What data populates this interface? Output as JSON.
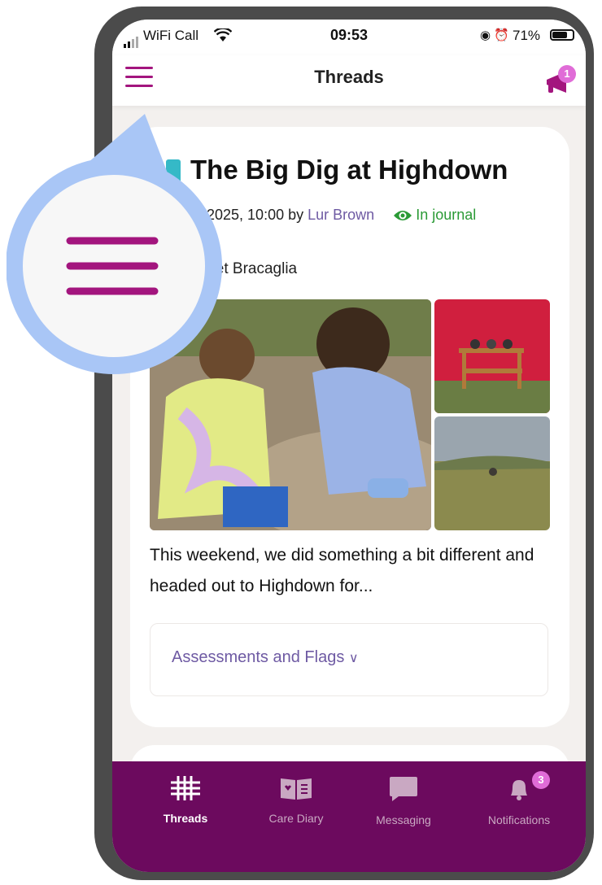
{
  "status_bar": {
    "carrier": "WiFi Call",
    "time": "09:53",
    "battery": "71%"
  },
  "nav": {
    "title": "Threads",
    "notification_count": "1"
  },
  "post": {
    "title": "The Big Dig at Highdown",
    "date": "2025, 10:00 by",
    "author": "Lur Brown",
    "visibility": "In journal",
    "child": "olet Bracaglia",
    "excerpt": "This weekend, we did something a bit different and headed out to Highdown for...",
    "assessments_label": "Assessments and Flags"
  },
  "tabs": [
    {
      "label": "Threads",
      "icon": "grid-icon"
    },
    {
      "label": "Care Diary",
      "icon": "book-icon"
    },
    {
      "label": "Messaging",
      "icon": "chat-icon"
    },
    {
      "label": "Notifications",
      "icon": "bell-icon",
      "badge": "3"
    }
  ],
  "colors": {
    "accent": "#a3157e",
    "tabbar": "#6c0a5e",
    "link": "#6e5aa3",
    "journal": "#2a9a35",
    "highlight": "#a9c6f6"
  }
}
